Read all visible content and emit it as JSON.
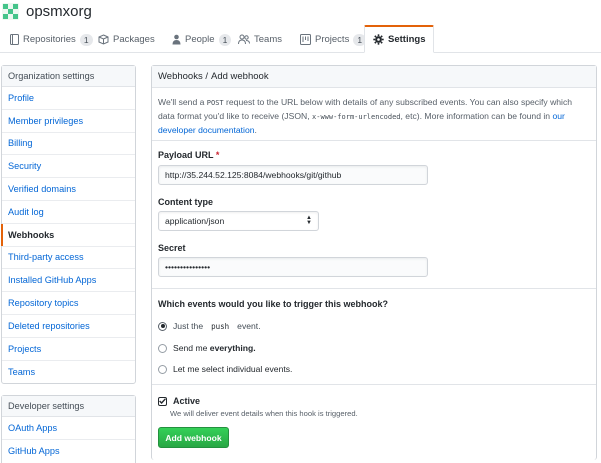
{
  "org": {
    "name": "opsmxorg"
  },
  "tabs": [
    {
      "label": "Repositories",
      "count": "1",
      "icon": "repo-icon"
    },
    {
      "label": "Packages",
      "count": "",
      "icon": "package-icon"
    },
    {
      "label": "People",
      "count": "1",
      "icon": "person-icon"
    },
    {
      "label": "Teams",
      "count": "",
      "icon": "team-icon"
    },
    {
      "label": "Projects",
      "count": "1",
      "icon": "project-icon"
    },
    {
      "label": "Settings",
      "count": "",
      "icon": "gear-icon",
      "selected": true
    }
  ],
  "sidebar": {
    "org_heading": "Organization settings",
    "org_items": [
      "Profile",
      "Member privileges",
      "Billing",
      "Security",
      "Verified domains",
      "Audit log",
      "Webhooks",
      "Third-party access",
      "Installed GitHub Apps",
      "Repository topics",
      "Deleted repositories",
      "Projects",
      "Teams"
    ],
    "selected": "Webhooks",
    "dev_heading": "Developer settings",
    "dev_items": [
      "OAuth Apps",
      "GitHub Apps"
    ]
  },
  "main": {
    "breadcrumb": "Webhooks /",
    "title": "Add webhook",
    "intro_1": "We'll send a ",
    "intro_post": "POST",
    "intro_2": " request to the URL below with details of any subscribed events. You can also specify which data format you'd like to receive (JSON, ",
    "intro_code": "x-www-form-urlencoded",
    "intro_3": ", etc). More information can be found in ",
    "intro_link": "our developer documentation",
    "intro_end": ".",
    "payload_label": "Payload URL",
    "payload_required": "*",
    "payload_value": "http://35.244.52.125:8084/webhooks/git/github",
    "content_type_label": "Content type",
    "content_type_value": "application/json",
    "secret_label": "Secret",
    "secret_value": "•••••••••••••••",
    "events_question": "Which events would you like to trigger this webhook?",
    "opt1_a": "Just the",
    "opt1_code": "push",
    "opt1_b": "event.",
    "opt2_a": "Send me ",
    "opt2_b": "everything.",
    "opt3": "Let me select individual events.",
    "active_label": "Active",
    "active_note": "We will deliver event details when this hook is triggered.",
    "submit_label": "Add webhook"
  },
  "colors": {
    "accent_tab": "#e36209",
    "link": "#0366d6",
    "button_green": "#28a745"
  }
}
